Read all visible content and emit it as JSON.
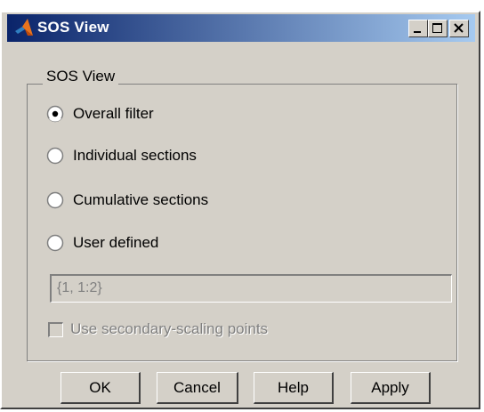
{
  "window": {
    "title": "SOS View",
    "icon": "matlab-logo-icon",
    "controls": [
      "minimize-icon",
      "maximize-icon",
      "close-icon"
    ]
  },
  "group": {
    "legend": "SOS View"
  },
  "options": [
    {
      "label": "Overall filter",
      "selected": true
    },
    {
      "label": "Individual sections",
      "selected": false
    },
    {
      "label": "Cumulative sections",
      "selected": false
    },
    {
      "label": "User defined",
      "selected": false
    }
  ],
  "user_defined_input": {
    "value": "{1, 1:2}",
    "enabled": false
  },
  "secondary_scaling": {
    "label": "Use secondary-scaling points",
    "checked": false,
    "enabled": false
  },
  "buttons": {
    "ok": "OK",
    "cancel": "Cancel",
    "help": "Help",
    "apply": "Apply"
  },
  "colors": {
    "face": "#d4d0c8",
    "title_start": "#0a246a",
    "title_end": "#a6caf0",
    "disabled_text": "#808080"
  }
}
